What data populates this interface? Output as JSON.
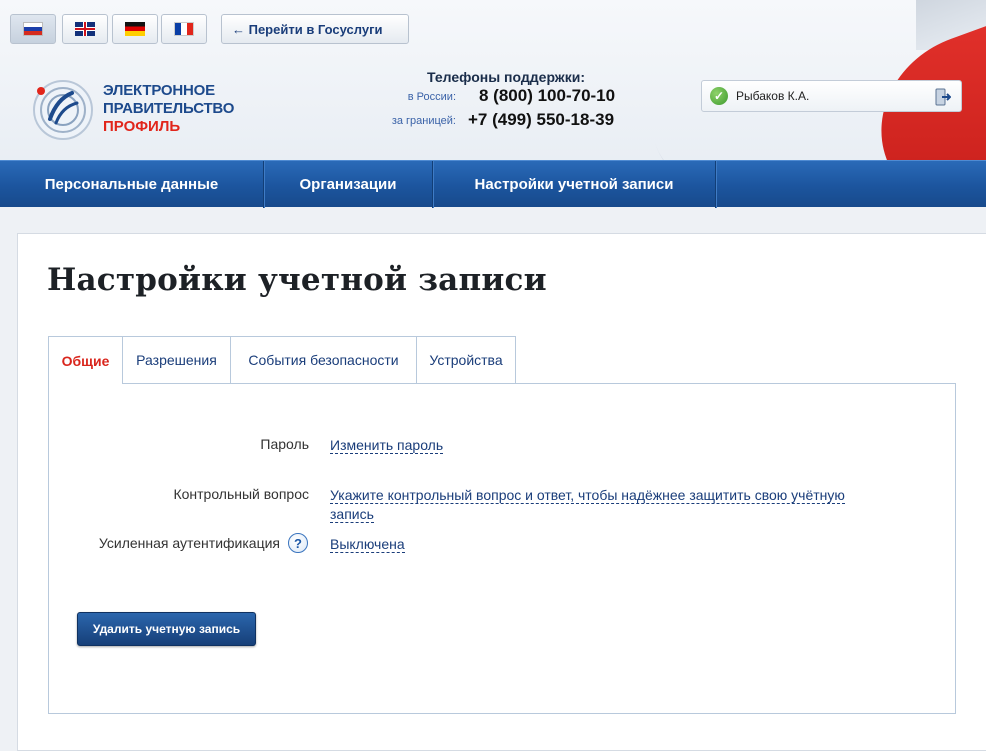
{
  "header": {
    "goto_label": "← Перейти в Госуслуги",
    "logo": {
      "line1": "ЭЛЕКТРОННОЕ",
      "line2": "ПРАВИТЕЛЬСТВО",
      "line3": "ПРОФИЛЬ"
    },
    "phones": {
      "title": "Телефоны поддержки:",
      "russia_label": "в России:",
      "russia_number": "8 (800) 100-70-10",
      "abroad_label": "за границей:",
      "abroad_number": "+7 (499) 550-18-39"
    },
    "user": {
      "name": "Рыбаков К.А.",
      "status_icon": "check-icon",
      "logout_icon": "exit-icon"
    },
    "languages": [
      {
        "code": "ru",
        "icon": "flag-ru-icon",
        "active": true
      },
      {
        "code": "en",
        "icon": "flag-gb-icon",
        "active": false
      },
      {
        "code": "de",
        "icon": "flag-de-icon",
        "active": false
      },
      {
        "code": "fr",
        "icon": "flag-fr-icon",
        "active": false
      }
    ]
  },
  "nav": {
    "items": [
      {
        "label": "Персональные данные"
      },
      {
        "label": "Организации"
      },
      {
        "label": "Настройки учетной записи",
        "active": true
      }
    ]
  },
  "main": {
    "title": "Настройки учетной записи",
    "tabs": [
      {
        "label": "Общие",
        "active": true
      },
      {
        "label": "Разрешения"
      },
      {
        "label": "События безопасности"
      },
      {
        "label": "Устройства"
      }
    ],
    "settings": {
      "password_label": "Пароль",
      "password_link": "Изменить пароль",
      "question_label": "Контрольный вопрос",
      "question_link_line1": "Укажите контрольный вопрос и ответ, чтобы надёжнее защитить свою учётную",
      "question_link_line2": "запись",
      "auth_label": "Усиленная аутентификация",
      "auth_help_icon": "?",
      "auth_value": "Выключена"
    },
    "delete_button": "Удалить учетную запись"
  },
  "colors": {
    "nav_blue": "#1c559e",
    "link_blue": "#1a3d7a",
    "active_tab_red": "#d9251c",
    "brand_red": "#e1251b"
  }
}
